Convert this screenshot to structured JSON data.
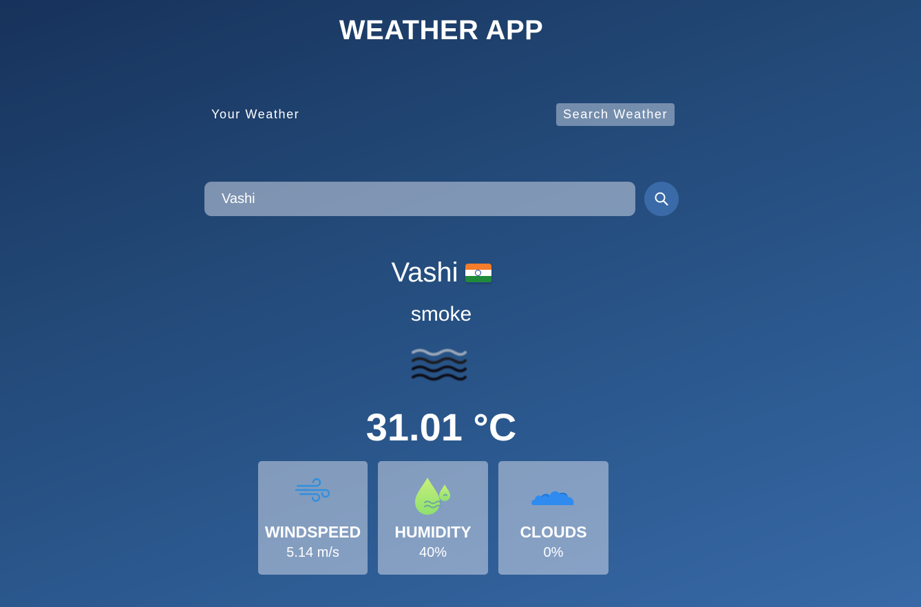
{
  "app": {
    "title": "WEATHER APP"
  },
  "tabs": {
    "your_weather": "Your Weather",
    "search_weather": "Search Weather",
    "active": "search_weather"
  },
  "search": {
    "value": "Vashi",
    "icon": "search-icon"
  },
  "weather": {
    "city": "Vashi",
    "country_flag": "india-flag",
    "description": "smoke",
    "icon": "smoke-icon",
    "temperature": "31.01 °C"
  },
  "stats": {
    "windspeed": {
      "label": "WINDSPEED",
      "value": "5.14 m/s",
      "icon": "wind-icon"
    },
    "humidity": {
      "label": "HUMIDITY",
      "value": "40%",
      "icon": "humidity-icon"
    },
    "clouds": {
      "label": "CLOUDS",
      "value": "0%",
      "icon": "cloud-icon"
    }
  },
  "colors": {
    "background_start": "#17325b",
    "background_end": "#3869a6",
    "search_button": "#3a6ba8",
    "card_background": "rgba(219,226,239,0.5)",
    "wind_icon": "#2f8fe0",
    "humidity_icon": "#b7ef6e",
    "cloud_icon": "#2f8bef"
  }
}
